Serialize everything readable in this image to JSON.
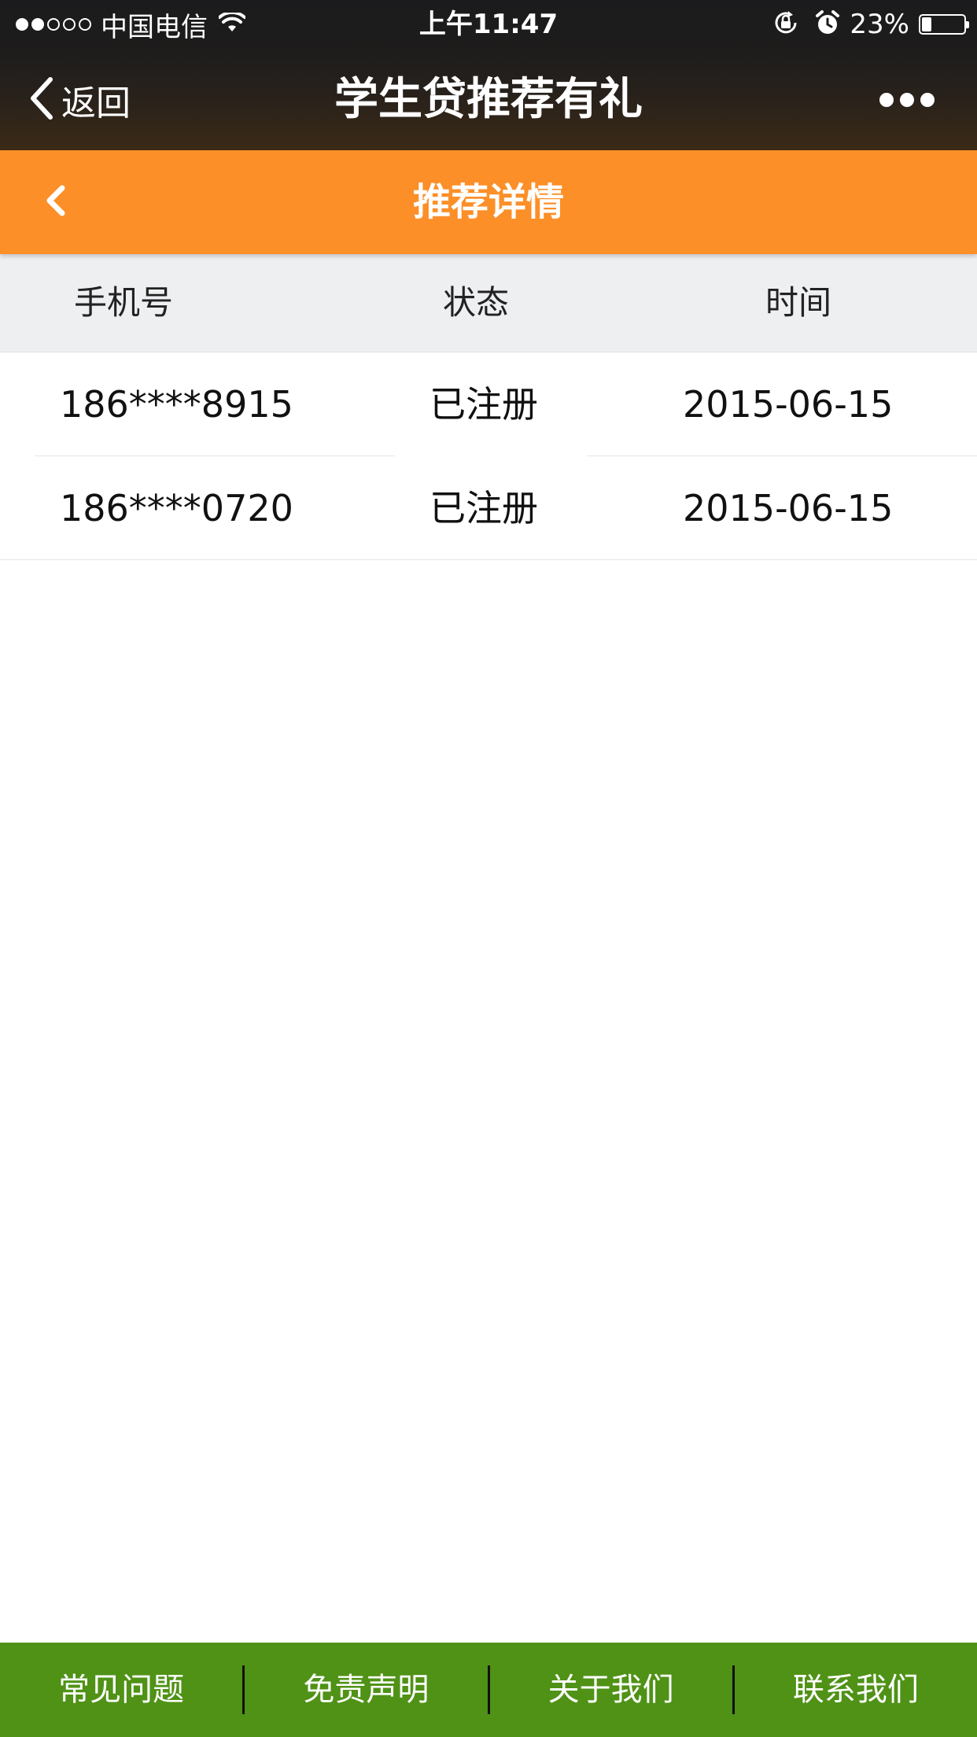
{
  "status_bar": {
    "signal_bars_filled": 2,
    "signal_bars_total": 5,
    "carrier": "中国电信",
    "time": "上午11:47",
    "battery_percent": "23%",
    "battery_level": 0.23
  },
  "nav": {
    "back_label": "返回",
    "title": "学生贷推荐有礼",
    "more_icon": "more-dots-icon"
  },
  "subheader": {
    "title": "推荐详情",
    "back_icon": "chevron-left-icon"
  },
  "table": {
    "headers": [
      "手机号",
      "状态",
      "时间"
    ],
    "rows": [
      {
        "phone": "186****8915",
        "status": "已注册",
        "time": "2015-06-15"
      },
      {
        "phone": "186****0720",
        "status": "已注册",
        "time": "2015-06-15"
      }
    ]
  },
  "footer": {
    "items": [
      "常见问题",
      "免责声明",
      "关于我们",
      "联系我们"
    ]
  },
  "colors": {
    "nav_bg": "#1e1d1c",
    "accent_orange": "#fc8f28",
    "footer_green": "#4f9216",
    "header_row_bg": "#eeeff1"
  }
}
